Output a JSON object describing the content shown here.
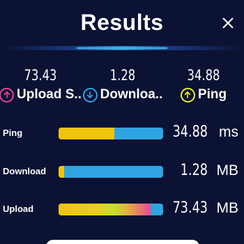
{
  "header": {
    "title": "Results"
  },
  "summary": [
    {
      "value": "73.43",
      "label": "Upload S..",
      "icon": "upload-arrow-icon",
      "color": "#e8489a"
    },
    {
      "value": "1.28",
      "label": "Downloa..",
      "icon": "download-arrow-icon",
      "color": "#2ea5e2"
    },
    {
      "value": "34.88",
      "label": "Ping",
      "icon": "ping-arrow-icon",
      "color": "#e9ef2e"
    }
  ],
  "rows": [
    {
      "name": "Ping",
      "value": "34.88",
      "unit": "ms",
      "fill_fraction": 0.53,
      "fill_style": "ping"
    },
    {
      "name": "Download",
      "value": "1.28",
      "unit": "MB",
      "fill_fraction": 0.05,
      "fill_style": "download"
    },
    {
      "name": "Upload",
      "value": "73.43",
      "unit": "MB",
      "fill_fraction": 0.88,
      "fill_style": "upload"
    }
  ],
  "colors": {
    "background": "#0b1233",
    "bar_track": "#2ea5e2",
    "ping_fill": "#f1c40f",
    "accent": "#2aa6e8"
  }
}
